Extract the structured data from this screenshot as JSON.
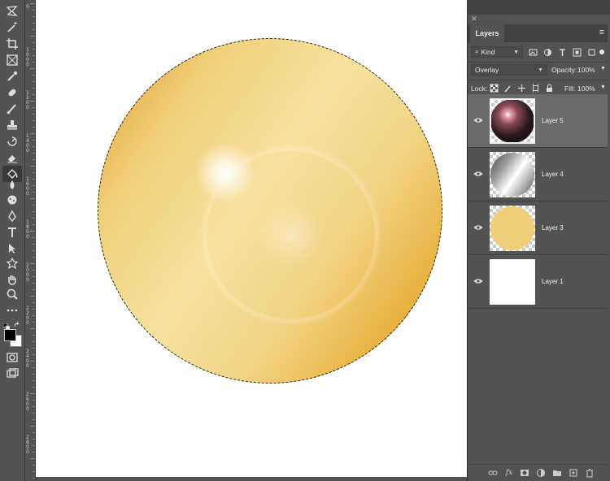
{
  "panel": {
    "tab_label": "Layers",
    "filter_label": "Kind",
    "blend_mode": "Overlay",
    "opacity_label": "Opacity:",
    "opacity_value": "100%",
    "lock_label": "Lock:",
    "fill_label": "Fill:",
    "fill_value": "100%"
  },
  "layers": [
    {
      "name": "Layer 5",
      "selected": true
    },
    {
      "name": "Layer 4",
      "selected": false
    },
    {
      "name": "Layer 3",
      "selected": false
    },
    {
      "name": "Layer 1",
      "selected": false
    }
  ],
  "ruler": {
    "labels": [
      "0",
      "1\n0\n0\n0",
      "1\n2\n0\n0",
      "1\n4\n0\n0",
      "1\n6\n0\n0",
      "1\n8\n0\n0",
      "2\n0\n0\n0",
      "2\n2\n0\n0",
      "2\n4\n0\n0",
      "2\n6\n0\n0",
      "2\n8\n0\n0"
    ]
  },
  "colors": {
    "foreground": "#000000",
    "background": "#ffffff",
    "sphere_light": "#f6e3a0",
    "sphere_dark": "#d99a1c"
  }
}
